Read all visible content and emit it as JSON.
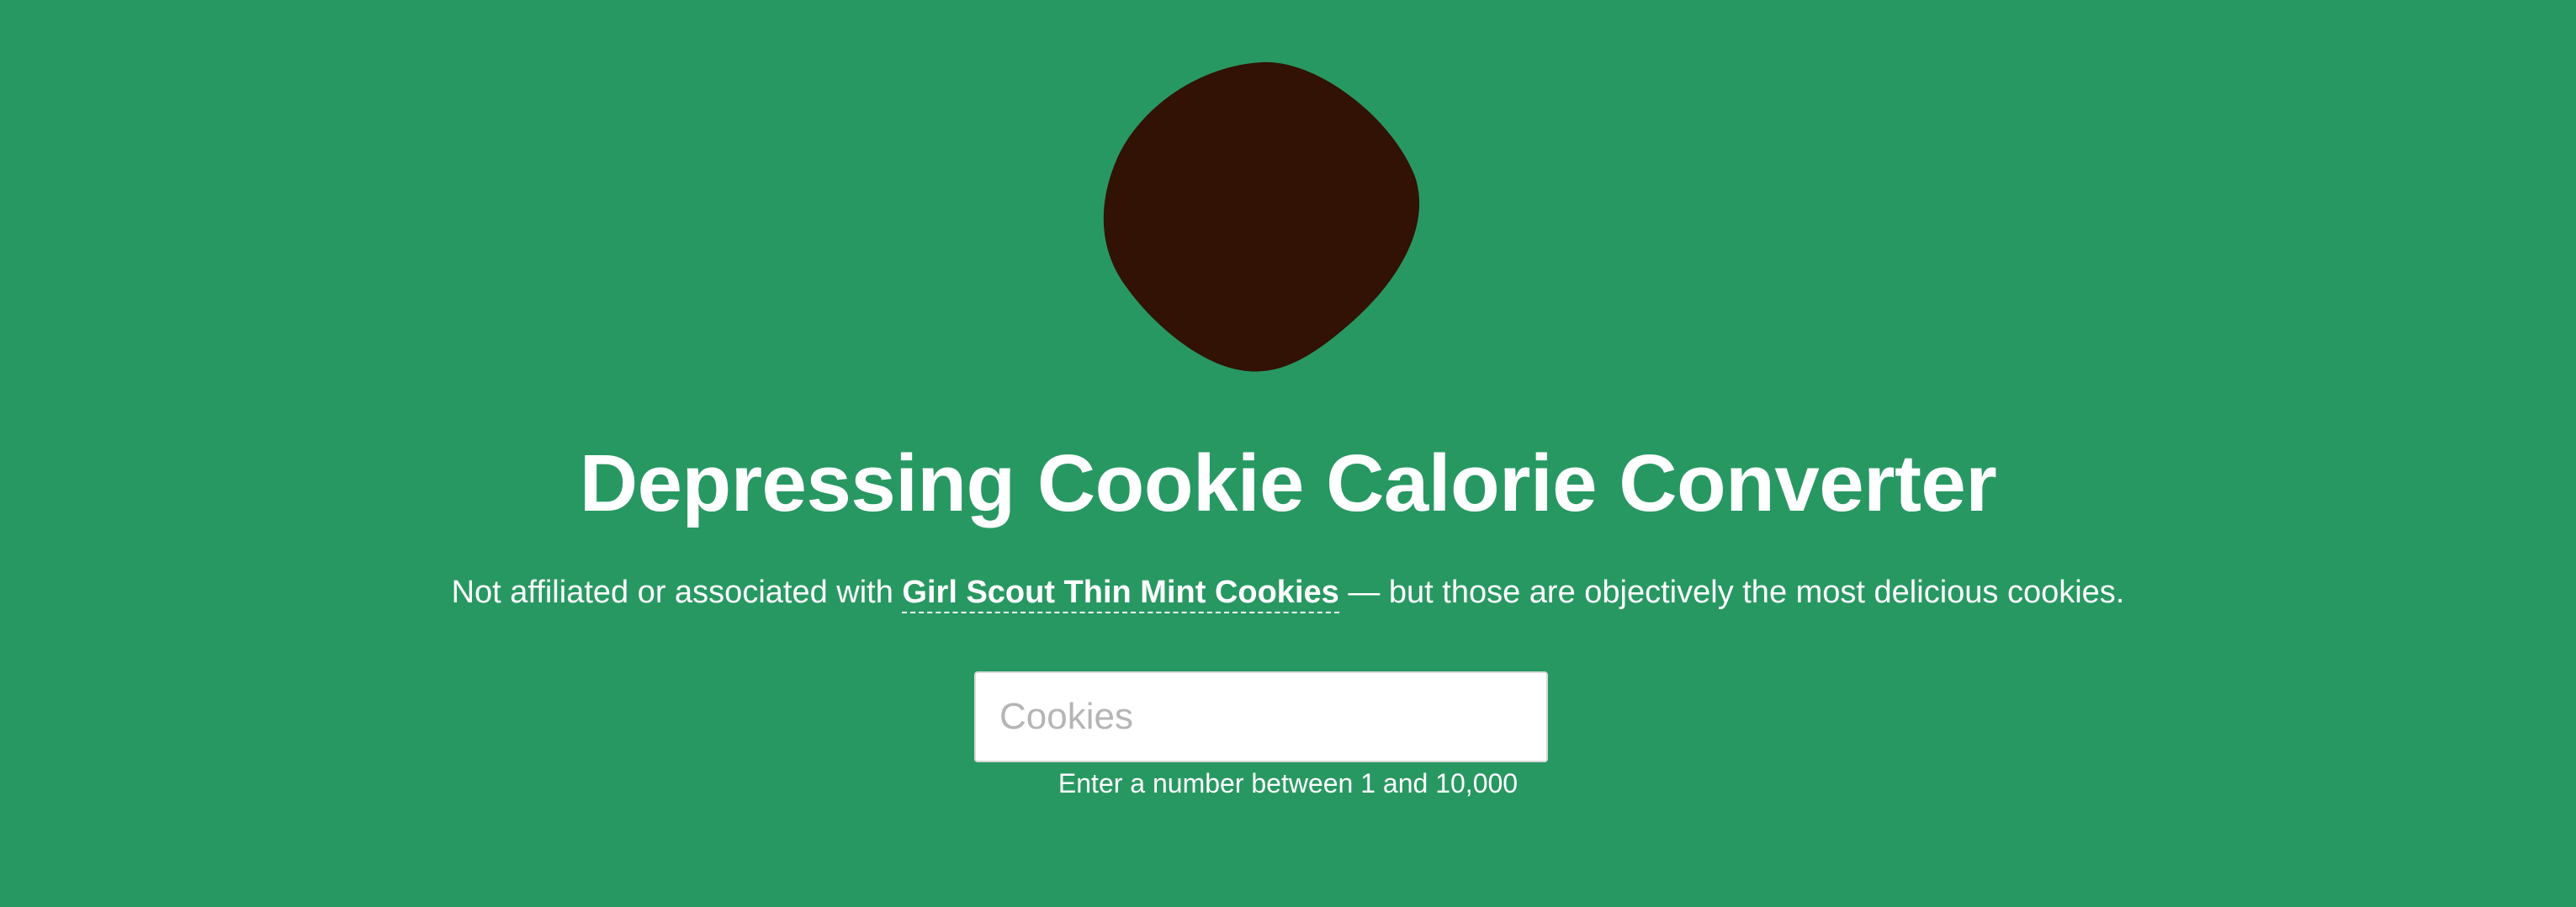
{
  "header": {
    "title": "Depressing Cookie Calorie Converter"
  },
  "intro": {
    "text_before": "Not affiliated or associated with ",
    "link_text": "Girl Scout Thin Mint Cookies",
    "text_after": " — but those are objectively the most delicious cookies."
  },
  "form": {
    "cookies_placeholder": "Cookies",
    "cookies_value": "",
    "hint": "Enter a number between 1 and 10,000"
  },
  "icons": {
    "logo": "cookie-icon"
  },
  "colors": {
    "background": "#289862",
    "cookie": "#311204",
    "text": "#ffffff",
    "input_background": "#ffffff",
    "placeholder": "#b5b5b5"
  }
}
